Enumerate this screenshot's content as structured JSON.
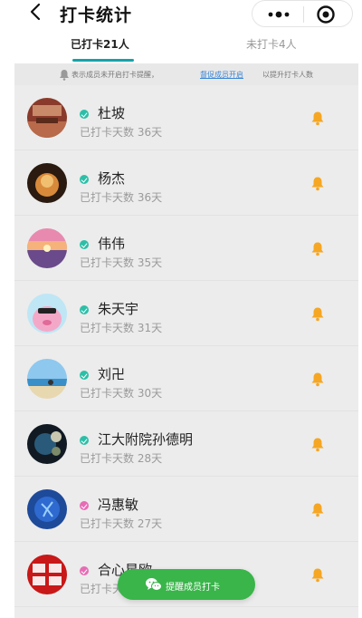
{
  "header": {
    "title": "打卡统计",
    "back_icon": "chevron-left-icon",
    "more_icon": "more-dots-icon",
    "target_icon": "target-icon"
  },
  "tabs": [
    {
      "label": "已打卡21人",
      "active": true
    },
    {
      "label": "未打卡4人",
      "active": false
    }
  ],
  "accent_color": "#16a2a8",
  "notice": {
    "text_before": "表示成员未开启打卡提醒，",
    "link": "督促成员开启",
    "text_after": "以提升打卡人数"
  },
  "members": [
    {
      "name": "杜坡",
      "days": "已打卡天数 36天",
      "status_color": "#2bbfa8"
    },
    {
      "name": "杨杰",
      "days": "已打卡天数 36天",
      "status_color": "#2bbfa8"
    },
    {
      "name": "伟伟",
      "days": "已打卡天数 35天",
      "status_color": "#2bbfa8"
    },
    {
      "name": "朱天宇",
      "days": "已打卡天数 31天",
      "status_color": "#2bbfa8"
    },
    {
      "name": "刘卍",
      "days": "已打卡天数 30天",
      "status_color": "#2bbfa8"
    },
    {
      "name": "江大附院孙德明",
      "days": "已打卡天数 28天",
      "status_color": "#2bbfa8"
    },
    {
      "name": "冯惠敏",
      "days": "已打卡天数 27天",
      "status_color": "#e86bb5"
    },
    {
      "name": "合心星欧",
      "days": "已打卡天数",
      "status_color": "#e86bb5"
    }
  ],
  "bell_color": "#f5a623",
  "fab": {
    "label": "提醒成员打卡",
    "icon": "wechat-icon",
    "color": "#39b54a"
  }
}
